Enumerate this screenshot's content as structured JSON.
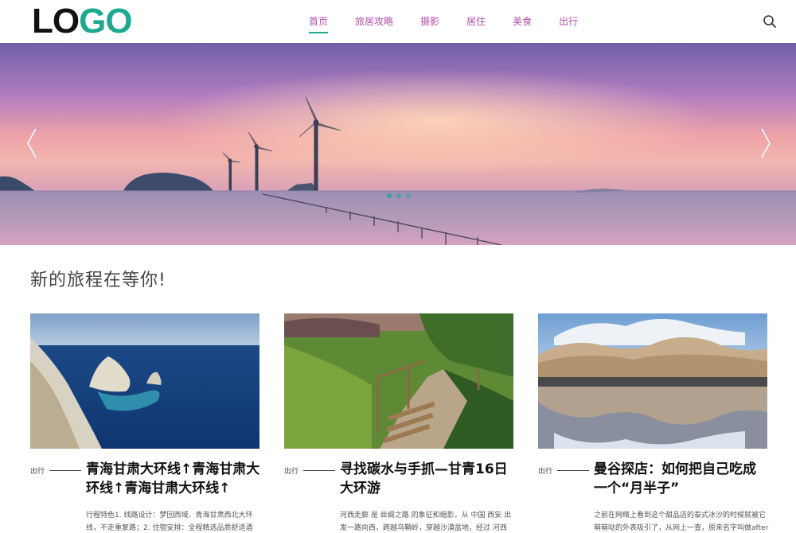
{
  "logo": {
    "part1": "LO",
    "part2": "GO"
  },
  "nav": {
    "items": [
      {
        "label": "首页",
        "active": true
      },
      {
        "label": "旅居攻略",
        "active": false
      },
      {
        "label": "摄影",
        "active": false
      },
      {
        "label": "居住",
        "active": false
      },
      {
        "label": "美食",
        "active": false
      },
      {
        "label": "出行",
        "active": false
      }
    ]
  },
  "icons": {
    "search": "search-icon",
    "prev": "chevron-left-icon",
    "next": "chevron-right-icon"
  },
  "colors": {
    "accent": "#1fa890",
    "nav_text": "#b24fa9"
  },
  "section": {
    "title": "新的旅程在等你!"
  },
  "carousel": {
    "slide_count": 3,
    "active_index": 0
  },
  "articles": [
    {
      "category": "出行",
      "title": "青海甘肃大环线↑青海甘肃大环线↑青海甘肃大环线↑",
      "excerpt": "行程特色1. 线路设计：梦回西域、青海甘肃西北大环线，不走重复路；2. 住宿安排：全程精选品质舒适酒"
    },
    {
      "category": "出行",
      "title": "寻找碳水与手抓—甘青16日大环游",
      "excerpt": "河西走廊 是 丝绸之路 的象征和缩影，从 中国 西安 出发一路向西，跨越乌鞘岭，穿越沙漠盆地，经过 河西"
    },
    {
      "category": "出行",
      "title": "曼谷探店：如何把自己吃成一个“月半子”",
      "excerpt": "之前在网络上看到这个甜品店的泰式冰沙的时候就被它萌萌哒的外表吸引了，从网上一查，原来名字叫做after"
    }
  ]
}
